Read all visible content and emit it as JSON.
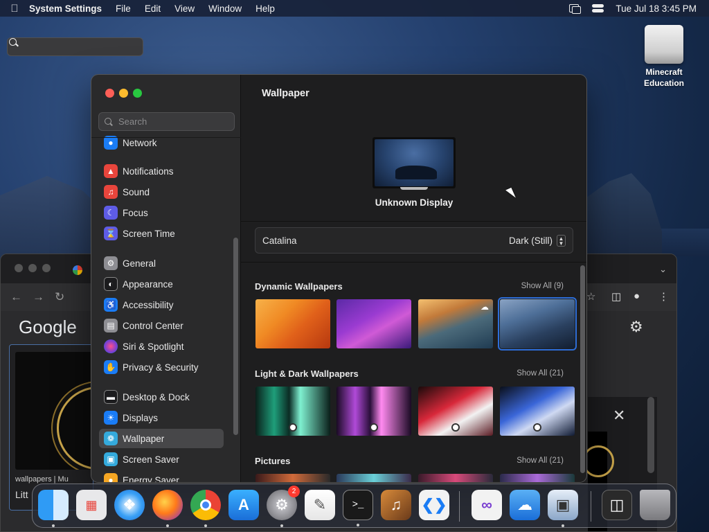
{
  "menubar": {
    "app_name": "System Settings",
    "menus": [
      "File",
      "Edit",
      "View",
      "Window",
      "Help"
    ],
    "datetime": "Tue Jul 18  3:45 PM"
  },
  "desktop": {
    "drive_label_1": "Minecraft",
    "drive_label_2": "Education"
  },
  "browser": {
    "logo_text": "Google",
    "card_caption": "wallpapers | Mu",
    "card_title": "Litt"
  },
  "settings": {
    "search": {
      "placeholder": "Search",
      "value": ""
    },
    "sidebar_partial": "Network",
    "sidebar": [
      {
        "label": "Notifications",
        "icon": "bell-icon",
        "color": "#e8453c"
      },
      {
        "label": "Sound",
        "icon": "speaker-icon",
        "color": "#e8453c"
      },
      {
        "label": "Focus",
        "icon": "moon-icon",
        "color": "#5e5ce6"
      },
      {
        "label": "Screen Time",
        "icon": "hourglass-icon",
        "color": "#5e5ce6"
      },
      {
        "label": "General",
        "icon": "gear-icon",
        "color": "#8e8e93"
      },
      {
        "label": "Appearance",
        "icon": "appearance-icon",
        "color": "#1c1c1e"
      },
      {
        "label": "Accessibility",
        "icon": "accessibility-icon",
        "color": "#1a7cf5"
      },
      {
        "label": "Control Center",
        "icon": "control-center-icon",
        "color": "#8e8e93"
      },
      {
        "label": "Siri & Spotlight",
        "icon": "siri-icon",
        "color": "#7a3fd1"
      },
      {
        "label": "Privacy & Security",
        "icon": "hand-icon",
        "color": "#1a7cf5"
      },
      {
        "label": "Desktop & Dock",
        "icon": "desktop-dock-icon",
        "color": "#1c1c1e"
      },
      {
        "label": "Displays",
        "icon": "sun-icon",
        "color": "#1a7cf5"
      },
      {
        "label": "Wallpaper",
        "icon": "wallpaper-icon",
        "color": "#34aadc"
      },
      {
        "label": "Screen Saver",
        "icon": "screen-saver-icon",
        "color": "#34aadc"
      },
      {
        "label": "Energy Saver",
        "icon": "bulb-icon",
        "color": "#f5a623"
      }
    ],
    "selected_item": "Wallpaper",
    "title": "Wallpaper",
    "display_name": "Unknown Display",
    "current_wallpaper": "Catalina",
    "appearance_mode": "Dark (Still)",
    "sections": [
      {
        "title": "Dynamic Wallpapers",
        "show_all": "Show All (9)"
      },
      {
        "title": "Light & Dark Wallpapers",
        "show_all": "Show All (21)"
      },
      {
        "title": "Pictures",
        "show_all": "Show All (21)"
      }
    ]
  },
  "dock": {
    "apps": [
      "Finder",
      "Launchpad",
      "Safari",
      "Firefox",
      "Google Chrome",
      "App Store",
      "System Settings",
      "TextEdit",
      "Terminal",
      "GarageBand",
      "Visual Studio Code",
      "Visual Studio",
      "iCloud",
      "Preview",
      "Screenshot",
      "Trash"
    ],
    "settings_badge": "2"
  }
}
